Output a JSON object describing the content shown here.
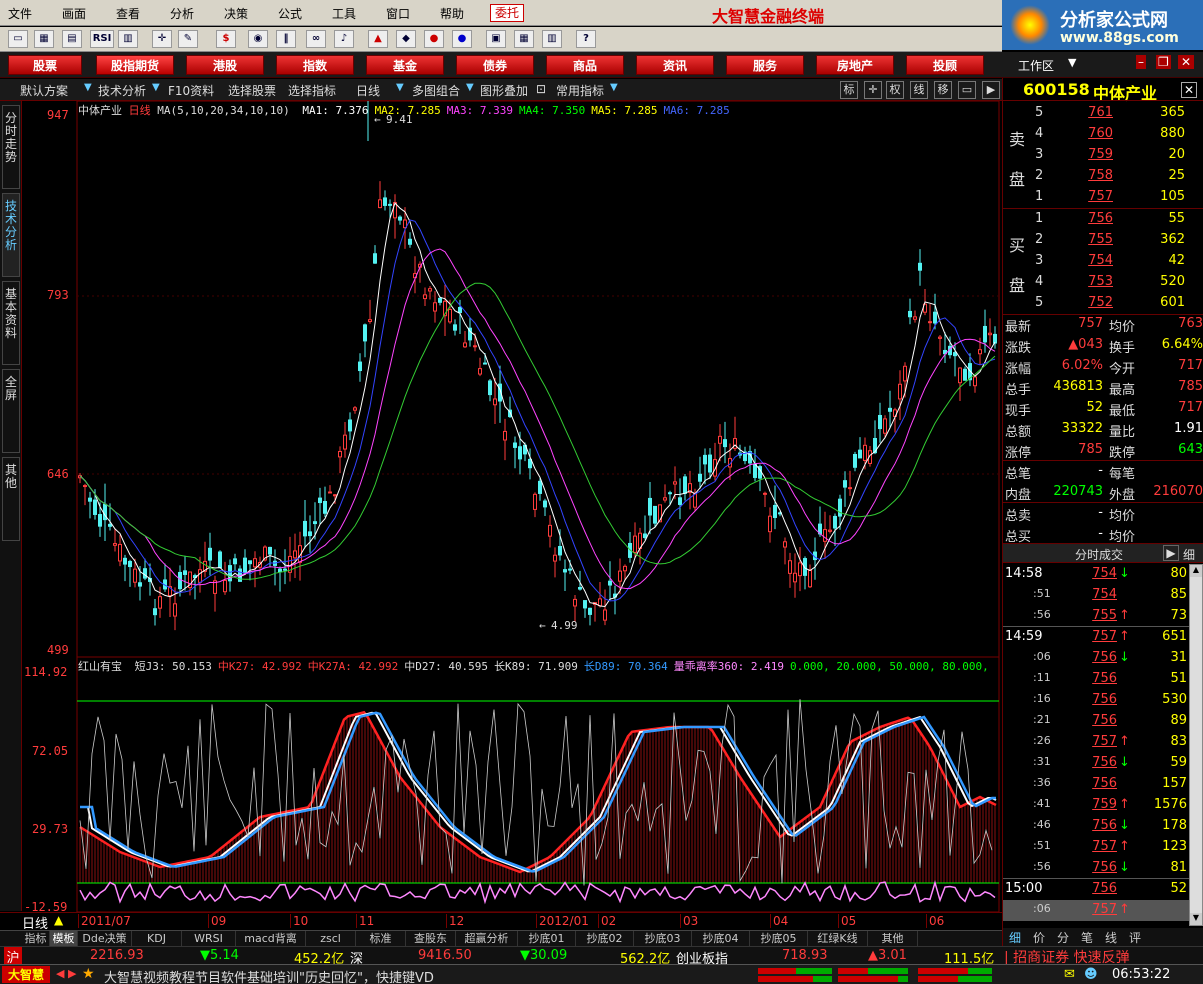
{
  "menu": [
    "文件",
    "画面",
    "查看",
    "分析",
    "决策",
    "公式",
    "工具",
    "窗口",
    "帮助"
  ],
  "weituo": "委托",
  "app_title": "大智慧金融终端",
  "brand": {
    "name": "分析家公式网",
    "url": "www.88gs.com"
  },
  "toolbar_rsi": "RSI",
  "categories": [
    "股票",
    "股指期货",
    "港股",
    "指数",
    "基金",
    "债券",
    "商品",
    "资讯",
    "服务",
    "房地产",
    "投顾"
  ],
  "work_area": "工作区",
  "chart_toolbar": [
    "默认方案",
    "技术分析",
    "F10资料",
    "选择股票",
    "选择指标",
    "日线",
    "多图组合",
    "图形叠加",
    "常用指标"
  ],
  "chart_toolbar_right": [
    "标",
    "权",
    "线",
    "移"
  ],
  "left_tabs": [
    "分时走势",
    "技术分析",
    "基本资料",
    "全屏",
    "其他"
  ],
  "main": {
    "title": "中体产业",
    "period": "日线",
    "ma_params": "MA(5,10,20,34,10,10)",
    "mas": [
      {
        "label": "MA1: 7.376",
        "color": "#ffffff"
      },
      {
        "label": "MA2: 7.285",
        "color": "#ffff00"
      },
      {
        "label": "MA3: 7.339",
        "color": "#ff44ff"
      },
      {
        "label": "MA4: 7.350",
        "color": "#00ff00"
      },
      {
        "label": "MA5: 7.285",
        "color": "#ffff00"
      },
      {
        "label": "MA6: 7.285",
        "color": "#4466ff"
      }
    ],
    "y_labels": [
      "947",
      "793",
      "646",
      "499"
    ],
    "high_label": "9.41",
    "low_label": "4.99"
  },
  "sub": {
    "title": "红山有宝",
    "labels": [
      {
        "t": "短J3: 50.153",
        "c": "#dddddd"
      },
      {
        "t": "中K27: 42.992",
        "c": "#ff3c3c"
      },
      {
        "t": "中K27A: 42.992",
        "c": "#ff3c3c"
      },
      {
        "t": "中D27: 40.595",
        "c": "#dddddd"
      },
      {
        "t": "长K89: 71.909",
        "c": "#dddddd"
      },
      {
        "t": "长D89: 70.364",
        "c": "#3399ff"
      },
      {
        "t": "量乖离率360: 2.419",
        "c": "#ff88ff"
      },
      {
        "t": "0.000, 20.000, 50.000, 80.000,",
        "c": "#00ff00"
      }
    ],
    "y_labels": [
      "114.92",
      "72.05",
      "29.73",
      "-12.59"
    ]
  },
  "period_label": "日线",
  "dates": [
    "2011/07",
    "09",
    "10",
    "11",
    "12",
    "2012/01",
    "02",
    "03",
    "04",
    "05",
    "06"
  ],
  "indicator_tabs": [
    "指标",
    "模板",
    "Dde决策",
    "KDJ",
    "WRSI",
    "macd背离",
    "zscl",
    "标准",
    "查股东",
    "超赢分析",
    "抄底01",
    "抄底02",
    "抄底03",
    "抄底04",
    "抄底05",
    "红绿K线",
    "其他"
  ],
  "status1": {
    "sh": "沪",
    "sh_idx": "2216.93",
    "sh_chg": "▼5.14",
    "sh_amt": "452.2亿",
    "sz": "深",
    "sz_idx": "9416.50",
    "sz_chg": "▼30.09",
    "sz_amt": "562.2亿",
    "cy": "创业板指",
    "cy_idx": "718.93",
    "cy_chg": "▲3.01",
    "cy_amt": "111.5亿",
    "broker": "招商证券 快速反弹"
  },
  "status2": {
    "logo": "大智慧",
    "ticker": "大智慧视频教程节目软件基础培训\"历史回忆\"，快捷键VD",
    "time": "06:53:22"
  },
  "quote": {
    "code": "600158",
    "name": "中体产业",
    "sell_label": [
      "卖",
      "盘"
    ],
    "buy_label": [
      "买",
      "盘"
    ],
    "asks": [
      {
        "n": "5",
        "p": "761",
        "v": "365"
      },
      {
        "n": "4",
        "p": "760",
        "v": "880"
      },
      {
        "n": "3",
        "p": "759",
        "v": "20"
      },
      {
        "n": "2",
        "p": "758",
        "v": "25"
      },
      {
        "n": "1",
        "p": "757",
        "v": "105"
      }
    ],
    "bids": [
      {
        "n": "1",
        "p": "756",
        "v": "55"
      },
      {
        "n": "2",
        "p": "755",
        "v": "362"
      },
      {
        "n": "3",
        "p": "754",
        "v": "42"
      },
      {
        "n": "4",
        "p": "753",
        "v": "520"
      },
      {
        "n": "5",
        "p": "752",
        "v": "601"
      }
    ],
    "stats": [
      {
        "l1": "最新",
        "v1": "757",
        "c1": "red",
        "l2": "均价",
        "v2": "763",
        "c2": "red"
      },
      {
        "l1": "涨跌",
        "v1": "▲043",
        "c1": "red",
        "l2": "换手",
        "v2": "6.64%",
        "c2": "yel"
      },
      {
        "l1": "涨幅",
        "v1": "6.02%",
        "c1": "red",
        "l2": "今开",
        "v2": "717",
        "c2": "red"
      },
      {
        "l1": "总手",
        "v1": "436813",
        "c1": "yel",
        "l2": "最高",
        "v2": "785",
        "c2": "red"
      },
      {
        "l1": "现手",
        "v1": "52",
        "c1": "yel",
        "l2": "最低",
        "v2": "717",
        "c2": "red"
      },
      {
        "l1": "总额",
        "v1": "33322",
        "c1": "yel",
        "l2": "量比",
        "v2": "1.91",
        "c2": "wht"
      },
      {
        "l1": "涨停",
        "v1": "785",
        "c1": "red",
        "l2": "跌停",
        "v2": "643",
        "c2": "grn"
      },
      {
        "l1": "总笔",
        "v1": "-",
        "c1": "wht",
        "l2": "每笔",
        "v2": "",
        "c2": "wht"
      },
      {
        "l1": "内盘",
        "v1": "220743",
        "c1": "grn",
        "l2": "外盘",
        "v2": "216070",
        "c2": "red"
      },
      {
        "l1": "总卖",
        "v1": "-",
        "c1": "wht",
        "l2": "均价",
        "v2": "",
        "c2": "wht"
      },
      {
        "l1": "总买",
        "v1": "-",
        "c1": "wht",
        "l2": "均价",
        "v2": "",
        "c2": "wht"
      }
    ],
    "ticks_title": "分时成交",
    "ticks_btn": "细",
    "ticks": [
      {
        "t": "14:58",
        "p": "754",
        "a": "↓",
        "v": "80"
      },
      {
        "t": ":51",
        "p": "754",
        "a": "",
        "v": "85"
      },
      {
        "t": ":56",
        "p": "755",
        "a": "↑",
        "v": "73"
      },
      {
        "t": "14:59",
        "p": "757",
        "a": "↑",
        "v": "651"
      },
      {
        "t": ":06",
        "p": "756",
        "a": "↓",
        "v": "31"
      },
      {
        "t": ":11",
        "p": "756",
        "a": "",
        "v": "51"
      },
      {
        "t": ":16",
        "p": "756",
        "a": "",
        "v": "530"
      },
      {
        "t": ":21",
        "p": "756",
        "a": "",
        "v": "89"
      },
      {
        "t": ":26",
        "p": "757",
        "a": "↑",
        "v": "83"
      },
      {
        "t": ":31",
        "p": "756",
        "a": "↓",
        "v": "59"
      },
      {
        "t": ":36",
        "p": "756",
        "a": "",
        "v": "157"
      },
      {
        "t": ":41",
        "p": "759",
        "a": "↑",
        "v": "1576"
      },
      {
        "t": ":46",
        "p": "756",
        "a": "↓",
        "v": "178"
      },
      {
        "t": ":51",
        "p": "757",
        "a": "↑",
        "v": "123"
      },
      {
        "t": ":56",
        "p": "756",
        "a": "↓",
        "v": "81"
      },
      {
        "t": "15:00",
        "p": "756",
        "a": "",
        "v": "52"
      },
      {
        "t": ":06",
        "p": "757",
        "a": "↑",
        "v": ""
      }
    ],
    "bottom_tabs": [
      "细",
      "价",
      "分",
      "笔",
      "线",
      "评"
    ]
  }
}
